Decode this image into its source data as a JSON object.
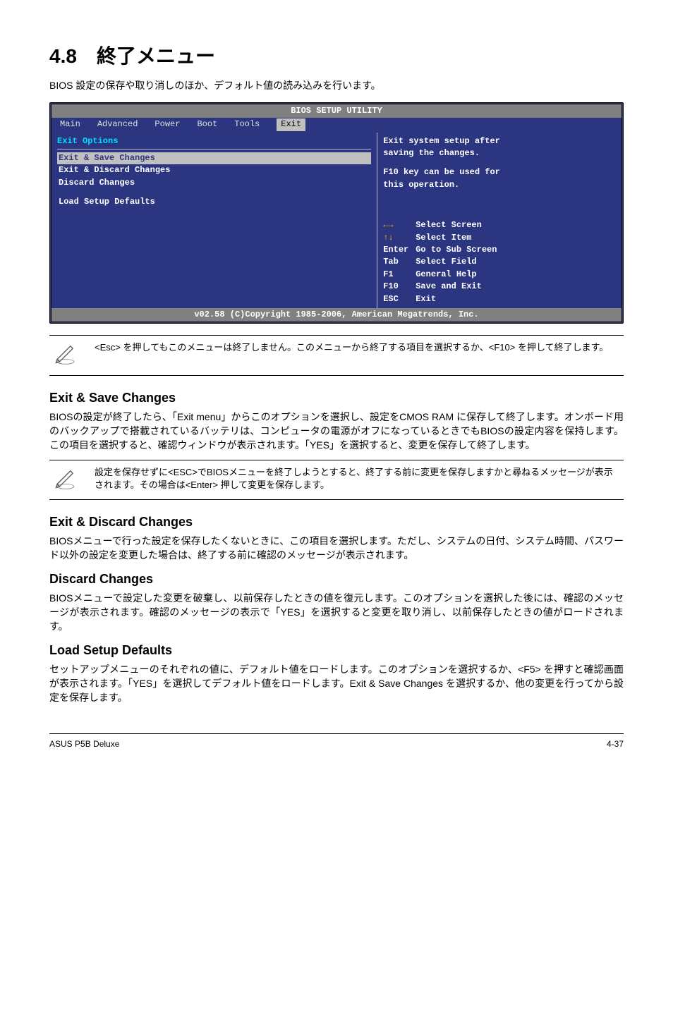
{
  "title_num": "4.8",
  "title_text": "終了メニュー",
  "intro": "BIOS 設定の保存や取り消しのほか、デフォルト値の読み込みを行います。",
  "bios": {
    "util_title": "BIOS SETUP UTILITY",
    "tabs": {
      "main": "Main",
      "advanced": "Advanced",
      "power": "Power",
      "boot": "Boot",
      "tools": "Tools",
      "exit": "Exit"
    },
    "left_title": "Exit Options",
    "options": {
      "o0": "Exit & Save Changes",
      "o1": "Exit & Discard Changes",
      "o2": "Discard Changes",
      "o3": "Load Setup Defaults"
    },
    "right_desc_l1": "Exit system setup after",
    "right_desc_l2": "saving the changes.",
    "right_desc_l3": "F10 key can be used for",
    "right_desc_l4": "this operation.",
    "keys": {
      "k0": "Select Screen",
      "k1": "Select Item",
      "enter_k": "Enter",
      "enter_d": "Go to Sub Screen",
      "tab_k": "Tab",
      "tab_d": "Select Field",
      "f1_k": "F1",
      "f1_d": "General Help",
      "f10_k": "F10",
      "f10_d": "Save and Exit",
      "esc_k": "ESC",
      "esc_d": "Exit"
    },
    "footer": "v02.58 (C)Copyright 1985-2006, American Megatrends, Inc."
  },
  "note1": "<Esc> を押してもこのメニューは終了しません。このメニューから終了する項目を選択するか、<F10> を押して終了します。",
  "sec1_head": "Exit & Save Changes",
  "sec1_p": "BIOSの設定が終了したら、「Exit menu」からこのオプションを選択し、設定をCMOS RAM に保存して終了します。オンボード用のバックアップで搭載されているバッテリは、コンピュータの電源がオフになっているときでもBIOSの設定内容を保持します。この項目を選択すると、確認ウィンドウが表示されます。「YES」を選択すると、変更を保存して終了します。",
  "note2": "設定を保存せずに<ESC>でBIOSメニューを終了しようとすると、終了する前に変更を保存しますかと尋ねるメッセージが表示されます。その場合は<Enter> 押して変更を保存します。",
  "sec2_head": "Exit & Discard Changes",
  "sec2_p": "BIOSメニューで行った設定を保存したくないときに、この項目を選択します。ただし、システムの日付、システム時間、パスワード以外の設定を変更した場合は、終了する前に確認のメッセージが表示されます。",
  "sec3_head": "Discard Changes",
  "sec3_p": "BIOSメニューで設定した変更を破棄し、以前保存したときの値を復元します。このオプションを選択した後には、確認のメッセージが表示されます。確認のメッセージの表示で「YES」を選択すると変更を取り消し、以前保存したときの値がロードされます。",
  "sec4_head": "Load Setup Defaults",
  "sec4_p": "セットアップメニューのそれぞれの値に、デフォルト値をロードします。このオプションを選択するか、<F5> を押すと確認画面が表示されます。「YES」を選択してデフォルト値をロードします。Exit & Save Changes を選択するか、他の変更を行ってから設定を保存します。",
  "foot_left": "ASUS P5B Deluxe",
  "foot_right": "4-37"
}
